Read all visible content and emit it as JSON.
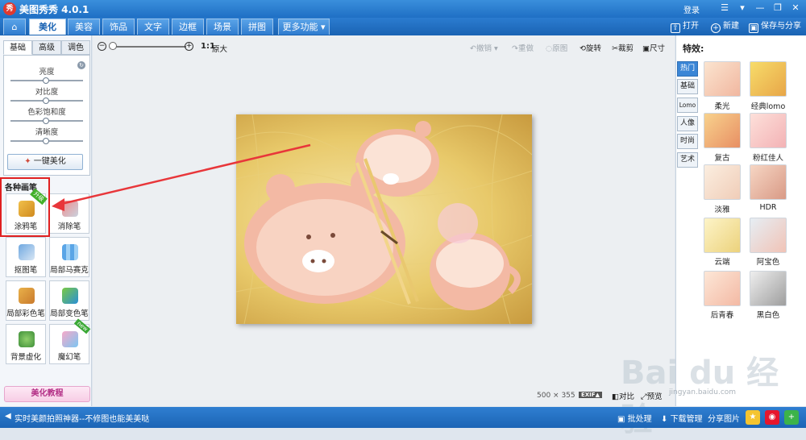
{
  "titlebar": {
    "title": "美图秀秀 4.0.1",
    "logo": "秀",
    "login": "登录"
  },
  "tabs": [
    {
      "label": "美化",
      "active": true
    },
    {
      "label": "美容"
    },
    {
      "label": "饰品"
    },
    {
      "label": "文字"
    },
    {
      "label": "边框"
    },
    {
      "label": "场景"
    },
    {
      "label": "拼图"
    },
    {
      "label": "更多功能"
    }
  ],
  "top_actions": {
    "open": "打开",
    "new": "新建",
    "save_share": "保存与分享"
  },
  "left": {
    "tabs": [
      "基础",
      "高级",
      "调色"
    ],
    "sliders": [
      "亮度",
      "对比度",
      "色彩饱和度",
      "清晰度"
    ],
    "one_click": "一键美化",
    "brushes_title": "各种画笔",
    "tools": [
      {
        "label": "涂鸦笔",
        "badge": "升级"
      },
      {
        "label": "消除笔"
      },
      {
        "label": "抠图笔"
      },
      {
        "label": "局部马赛克"
      },
      {
        "label": "局部彩色笔"
      },
      {
        "label": "局部变色笔"
      },
      {
        "label": "背景虚化"
      },
      {
        "label": "魔幻笔",
        "badge": "new"
      }
    ],
    "tutorial": "美化教程"
  },
  "canvas": {
    "ratio": "1:1",
    "original": "原大",
    "undo": "撤销",
    "redo": "重做",
    "restore": "原图",
    "rotate": "旋转",
    "crop": "裁剪",
    "size": "尺寸",
    "dimensions": "500 × 355",
    "exif": "EXIF▲",
    "compare": "对比",
    "compare2": "预览"
  },
  "right": {
    "title": "特效:",
    "categories": [
      "热门",
      "基础",
      "Lomo",
      "人像",
      "时尚",
      "艺术"
    ],
    "effects": [
      "柔光",
      "经典lomo",
      "复古",
      "粉红佳人",
      "淡雅",
      "HDR",
      "云端",
      "阿宝色",
      "后青春",
      "黑白色"
    ]
  },
  "status": {
    "left": "实时美颜拍照神器--不修图也能美美哒",
    "batch": "批处理",
    "download": "下载管理",
    "share": "分享图片"
  },
  "watermark": "Bai du 经验",
  "watermark_sub": "jingyan.baidu.com",
  "colors": {
    "accent": "#1f6fc4",
    "highlight": "#e02020",
    "arrow": "#e8363a"
  }
}
